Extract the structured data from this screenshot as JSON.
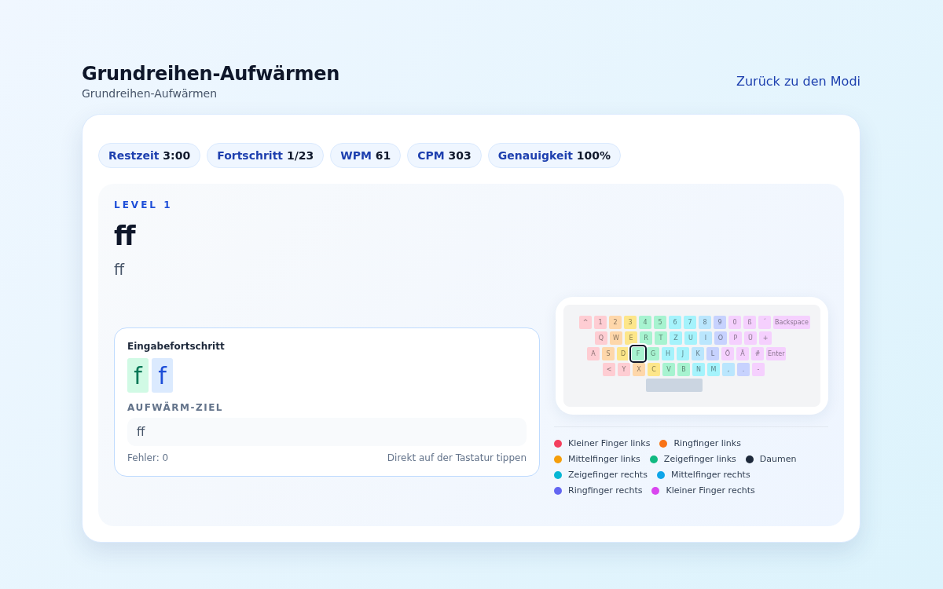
{
  "header": {
    "title": "Grundreihen-Aufwärmen",
    "subtitle": "Grundreihen-Aufwärmen",
    "back_link": "Zurück zu den Modi"
  },
  "stats": [
    {
      "label": "Restzeit",
      "value": "3:00"
    },
    {
      "label": "Fortschritt",
      "value": "1/23"
    },
    {
      "label": "WPM",
      "value": "61"
    },
    {
      "label": "CPM",
      "value": "303"
    },
    {
      "label": "Genauigkeit",
      "value": "100%"
    }
  ],
  "lesson": {
    "level": "LEVEL 1",
    "target": "ff",
    "hint": "ff"
  },
  "input_panel": {
    "title": "Eingabefortschritt",
    "typed": [
      {
        "char": "f",
        "current": false
      },
      {
        "char": "f",
        "current": true
      }
    ],
    "goal_label": "AUFWÄRM-ZIEL",
    "goal": "ff",
    "errors": "Fehler: 0",
    "instruction": "Direkt auf der Tastatur tippen"
  },
  "keyboard": {
    "rows": [
      [
        {
          "label": "^",
          "color": "#fecdd3",
          "active": false
        },
        {
          "label": "1",
          "color": "#fecdd3",
          "active": false
        },
        {
          "label": "2",
          "color": "#fed7aa",
          "active": false
        },
        {
          "label": "3",
          "color": "#fde68a",
          "active": false
        },
        {
          "label": "4",
          "color": "#a7f3d0",
          "active": false
        },
        {
          "label": "5",
          "color": "#a7f3d0",
          "active": false
        },
        {
          "label": "6",
          "color": "#a5f3fc",
          "active": false
        },
        {
          "label": "7",
          "color": "#a5f3fc",
          "active": false
        },
        {
          "label": "8",
          "color": "#bae6fd",
          "active": false
        },
        {
          "label": "9",
          "color": "#c7d2fe",
          "active": false
        },
        {
          "label": "0",
          "color": "#f5d0fe",
          "active": false
        },
        {
          "label": "ß",
          "color": "#f5d0fe",
          "active": false
        },
        {
          "label": "´",
          "color": "#f5d0fe",
          "active": false
        },
        {
          "label": "Backspace",
          "color": "#f5d0fe",
          "active": false,
          "kind": "wide"
        }
      ],
      [
        {
          "label": "Q",
          "color": "#fecdd3",
          "active": false
        },
        {
          "label": "W",
          "color": "#fed7aa",
          "active": false
        },
        {
          "label": "E",
          "color": "#fde68a",
          "active": false
        },
        {
          "label": "R",
          "color": "#a7f3d0",
          "active": false
        },
        {
          "label": "T",
          "color": "#a7f3d0",
          "active": false
        },
        {
          "label": "Z",
          "color": "#a5f3fc",
          "active": false
        },
        {
          "label": "U",
          "color": "#a5f3fc",
          "active": false
        },
        {
          "label": "I",
          "color": "#bae6fd",
          "active": false
        },
        {
          "label": "O",
          "color": "#c7d2fe",
          "active": false
        },
        {
          "label": "P",
          "color": "#f5d0fe",
          "active": false
        },
        {
          "label": "Ü",
          "color": "#f5d0fe",
          "active": false
        },
        {
          "label": "+",
          "color": "#f5d0fe",
          "active": false
        }
      ],
      [
        {
          "label": "A",
          "color": "#fecdd3",
          "active": false
        },
        {
          "label": "S",
          "color": "#fed7aa",
          "active": false
        },
        {
          "label": "D",
          "color": "#fde68a",
          "active": false
        },
        {
          "label": "F",
          "color": "#a7f3d0",
          "active": true
        },
        {
          "label": "G",
          "color": "#a7f3d0",
          "active": false
        },
        {
          "label": "H",
          "color": "#a5f3fc",
          "active": false
        },
        {
          "label": "J",
          "color": "#a5f3fc",
          "active": false
        },
        {
          "label": "K",
          "color": "#bae6fd",
          "active": false
        },
        {
          "label": "L",
          "color": "#c7d2fe",
          "active": false
        },
        {
          "label": "Ö",
          "color": "#f5d0fe",
          "active": false
        },
        {
          "label": "Ä",
          "color": "#f5d0fe",
          "active": false
        },
        {
          "label": "#",
          "color": "#f5d0fe",
          "active": false
        },
        {
          "label": "Enter",
          "color": "#f5d0fe",
          "active": false,
          "kind": "wide"
        }
      ],
      [
        {
          "label": "<",
          "color": "#fecdd3",
          "active": false
        },
        {
          "label": "Y",
          "color": "#fecdd3",
          "active": false
        },
        {
          "label": "X",
          "color": "#fed7aa",
          "active": false
        },
        {
          "label": "C",
          "color": "#fde68a",
          "active": false
        },
        {
          "label": "V",
          "color": "#a7f3d0",
          "active": false
        },
        {
          "label": "B",
          "color": "#a7f3d0",
          "active": false
        },
        {
          "label": "N",
          "color": "#a5f3fc",
          "active": false
        },
        {
          "label": "M",
          "color": "#a5f3fc",
          "active": false
        },
        {
          "label": ",",
          "color": "#bae6fd",
          "active": false
        },
        {
          "label": ".",
          "color": "#c7d2fe",
          "active": false
        },
        {
          "label": "-",
          "color": "#f5d0fe",
          "active": false
        }
      ],
      [
        {
          "kind": "space",
          "color": "#cbd5e1",
          "active": false
        }
      ]
    ]
  },
  "legend": [
    {
      "label": "Kleiner Finger links",
      "color": "#f43f5e"
    },
    {
      "label": "Ringfinger links",
      "color": "#f97316"
    },
    {
      "label": "Mittelfinger links",
      "color": "#f59e0b"
    },
    {
      "label": "Zeigefinger links",
      "color": "#10b981"
    },
    {
      "label": "Daumen",
      "color": "#1e293b"
    },
    {
      "label": "Zeigefinger rechts",
      "color": "#06b6d4"
    },
    {
      "label": "Mittelfinger rechts",
      "color": "#0ea5e9"
    },
    {
      "label": "Ringfinger rechts",
      "color": "#6366f1"
    },
    {
      "label": "Kleiner Finger rechts",
      "color": "#d946ef"
    }
  ]
}
